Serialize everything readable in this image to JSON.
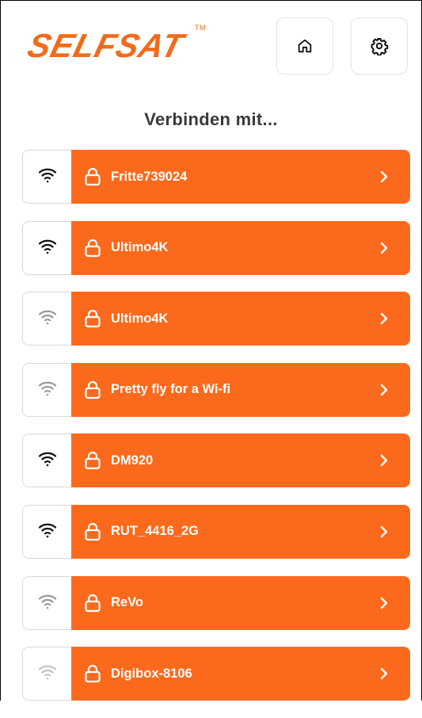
{
  "header": {
    "logo_text": "SELFSAT",
    "logo_tm": "TM",
    "home_icon": "home-icon",
    "settings_icon": "gear-icon"
  },
  "title": "Verbinden mit...",
  "colors": {
    "accent": "#fb6a1c",
    "logo": "#f26a1b",
    "text_dark": "#3a3a3a"
  },
  "networks": [
    {
      "name": "Fritte739024",
      "signal": "strong",
      "secured": true
    },
    {
      "name": "Ultimo4K",
      "signal": "strong",
      "secured": true
    },
    {
      "name": "Ultimo4K",
      "signal": "weak",
      "secured": true
    },
    {
      "name": "Pretty fly for a Wi-fi",
      "signal": "weak",
      "secured": true
    },
    {
      "name": "DM920",
      "signal": "strong",
      "secured": true
    },
    {
      "name": "RUT_4416_2G",
      "signal": "strong",
      "secured": true
    },
    {
      "name": "ReVo",
      "signal": "weak",
      "secured": true
    },
    {
      "name": "Digibox-8106",
      "signal": "faint",
      "secured": true
    }
  ]
}
